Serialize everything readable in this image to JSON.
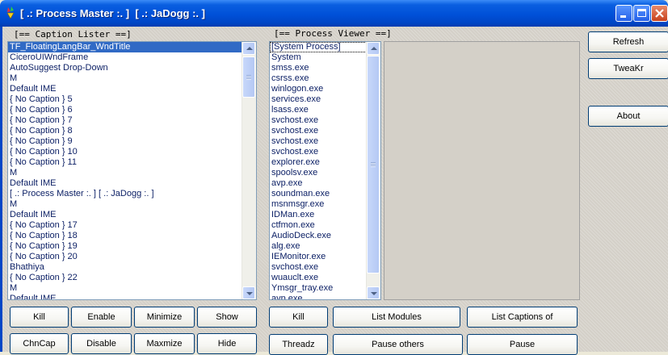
{
  "window": {
    "title": "[ .: Process Master :. ]  [ .: JaDogg :. ]"
  },
  "caption_lister": {
    "label": "[== Caption Lister ==]",
    "items": [
      "TF_FloatingLangBar_WndTitle",
      "CiceroUIWndFrame",
      "AutoSuggest Drop-Down",
      "M",
      "Default IME",
      "{ No Caption } 5",
      "{ No Caption } 6",
      "{ No Caption } 7",
      "{ No Caption } 8",
      "{ No Caption } 9",
      "{ No Caption } 10",
      "{ No Caption } 11",
      "M",
      "Default IME",
      "[ .: Process Master :. ]  [ .: JaDogg :. ]",
      "M",
      "Default IME",
      "{ No Caption } 17",
      "{ No Caption } 18",
      "{ No Caption } 19",
      "{ No Caption } 20",
      "Bhathiya",
      "{ No Caption } 22",
      "M",
      "Default IME"
    ],
    "buttons_row1": [
      "Kill",
      "Enable",
      "Minimize",
      "Show"
    ],
    "buttons_row2": [
      "ChnCap",
      "Disable",
      "Maxmize",
      "Hide"
    ]
  },
  "process_viewer": {
    "label": "[== Process Viewer ==]",
    "items": [
      "[System Process]",
      "System",
      "smss.exe",
      "csrss.exe",
      "winlogon.exe",
      "services.exe",
      "lsass.exe",
      "svchost.exe",
      "svchost.exe",
      "svchost.exe",
      "svchost.exe",
      "explorer.exe",
      "spoolsv.exe",
      "avp.exe",
      "soundman.exe",
      "msnmsgr.exe",
      "IDMan.exe",
      "ctfmon.exe",
      "AudioDeck.exe",
      "alg.exe",
      "IEMonitor.exe",
      "svchost.exe",
      "wuauclt.exe",
      "Ymsgr_tray.exe",
      "avp.exe"
    ],
    "buttons_row1": [
      "Kill",
      "List Modules",
      "List Captions of"
    ],
    "buttons_row2": [
      "Threadz",
      "Pause others",
      "Pause"
    ]
  },
  "side_buttons": {
    "refresh": "Refresh",
    "tweakr": "TweaKr",
    "about": "About"
  }
}
